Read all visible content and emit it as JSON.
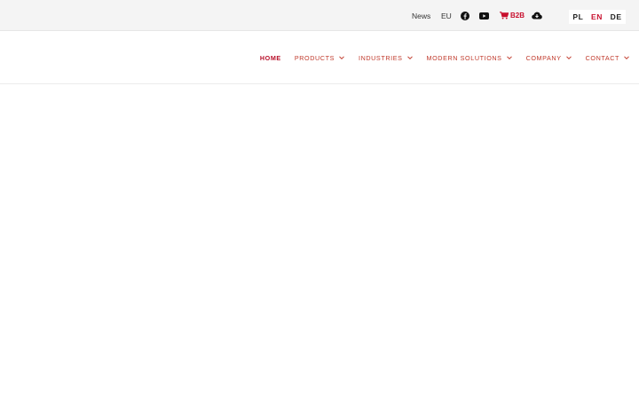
{
  "topbar": {
    "news_label": "News",
    "region_label": "EU",
    "facebook_icon": "facebook-icon",
    "youtube_icon": "youtube-icon",
    "b2b_label": "B2B",
    "cart_icon": "cart-icon",
    "download_icon": "cloud-download-icon"
  },
  "languages": [
    {
      "code": "PL",
      "active": false
    },
    {
      "code": "EN",
      "active": true
    },
    {
      "code": "DE",
      "active": false
    }
  ],
  "nav": {
    "items": [
      {
        "label": "HOME",
        "active": true,
        "dropdown": false
      },
      {
        "label": "PRODUCTS",
        "dropdown": true
      },
      {
        "label": "INDUSTRIES",
        "dropdown": true
      },
      {
        "label": "MODERN SOLUTIONS",
        "dropdown": true
      },
      {
        "label": "COMPANY",
        "dropdown": true
      },
      {
        "label": "CONTACT",
        "dropdown": true
      }
    ]
  },
  "colors": {
    "accent": "#c8102e",
    "topbar_bg": "#f4f4f4",
    "nav_text": "#c0392b"
  }
}
